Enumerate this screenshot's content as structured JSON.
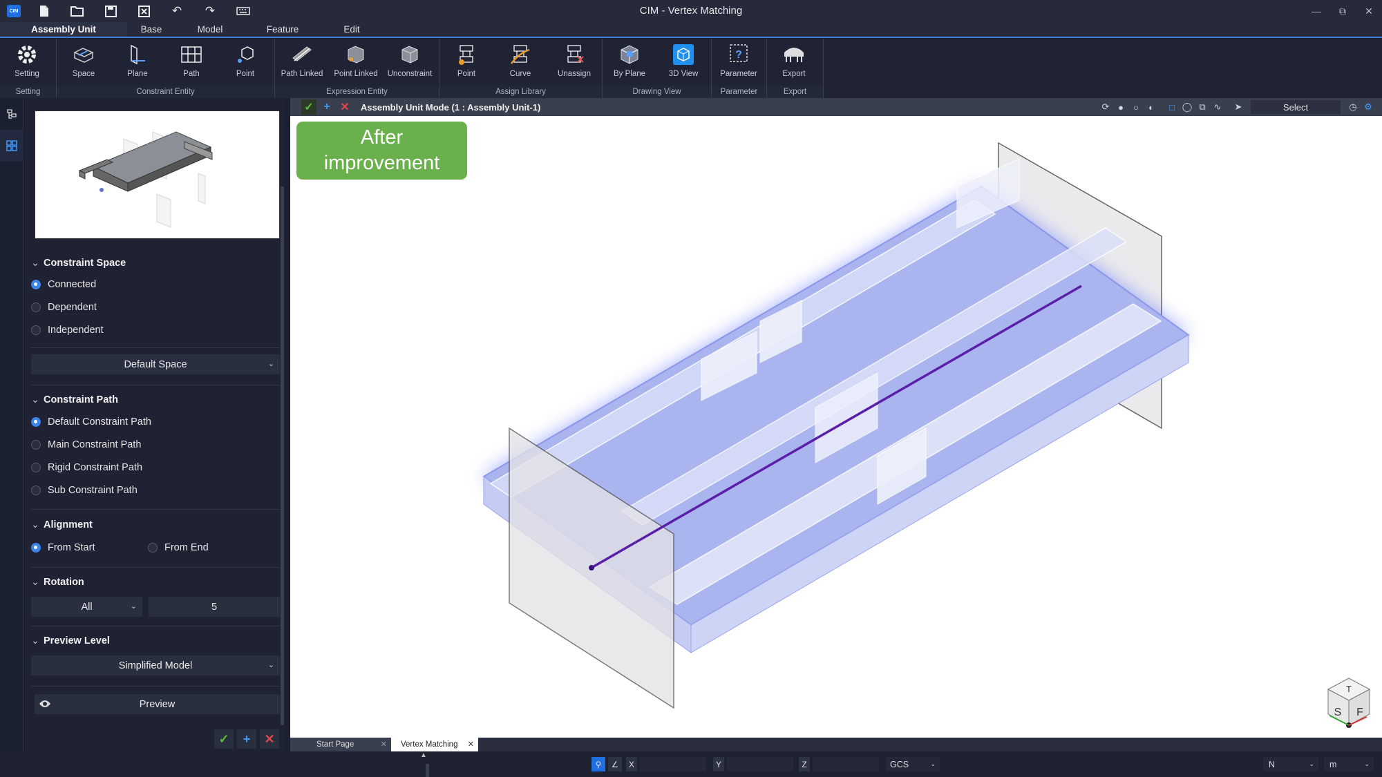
{
  "app": {
    "title": "CIM - Vertex Matching",
    "logo_text": "CIM"
  },
  "menu": {
    "tabs": [
      "Assembly Unit",
      "Base",
      "Model",
      "Feature",
      "Edit"
    ]
  },
  "ribbon": {
    "groups": [
      {
        "label": "Setting",
        "buttons": [
          "Setting"
        ]
      },
      {
        "label": "Constraint Entity",
        "buttons": [
          "Space",
          "Plane",
          "Path",
          "Point"
        ]
      },
      {
        "label": "Expression Entity",
        "buttons": [
          "Path Linked",
          "Point Linked",
          "Unconstraint"
        ]
      },
      {
        "label": "Assign Library",
        "buttons": [
          "Point",
          "Curve",
          "Unassign"
        ]
      },
      {
        "label": "Drawing View",
        "buttons": [
          "By Plane",
          "3D View"
        ]
      },
      {
        "label": "Parameter",
        "buttons": [
          "Parameter"
        ]
      },
      {
        "label": "Export",
        "buttons": [
          "Export"
        ]
      }
    ]
  },
  "panel": {
    "constraint_space": {
      "title": "Constraint Space",
      "options": [
        "Connected",
        "Dependent",
        "Independent"
      ],
      "selected": "Connected",
      "dropdown": "Default Space"
    },
    "constraint_path": {
      "title": "Constraint Path",
      "options": [
        "Default Constraint Path",
        "Main Constraint Path",
        "Rigid Constraint Path",
        "Sub Constraint Path"
      ],
      "selected": "Default Constraint Path"
    },
    "alignment": {
      "title": "Alignment",
      "options": [
        "From Start",
        "From End"
      ],
      "selected": "From Start"
    },
    "rotation": {
      "title": "Rotation",
      "axis": "All",
      "value": "5"
    },
    "preview_level": {
      "title": "Preview Level",
      "value": "Simplified Model"
    },
    "preview_button": "Preview"
  },
  "viewport": {
    "mode_title": "Assembly Unit Mode (1 : Assembly Unit-1)",
    "select_label": "Select",
    "badge_line1": "After",
    "badge_line2": "improvement",
    "navcube": {
      "top": "T",
      "left": "S",
      "right": "F"
    }
  },
  "doc_tabs": [
    {
      "label": "Start Page",
      "active": false
    },
    {
      "label": "Vertex Matching",
      "active": true
    }
  ],
  "status": {
    "x_label": "X",
    "y_label": "Y",
    "z_label": "Z",
    "x": "",
    "y": "",
    "z": "",
    "cs": "GCS",
    "dir": "N",
    "unit": "m"
  },
  "colors": {
    "accent": "#3d85e8",
    "badge": "#6ab04c",
    "path_line": "#5a1fa8",
    "glow": "#4d62ff"
  }
}
